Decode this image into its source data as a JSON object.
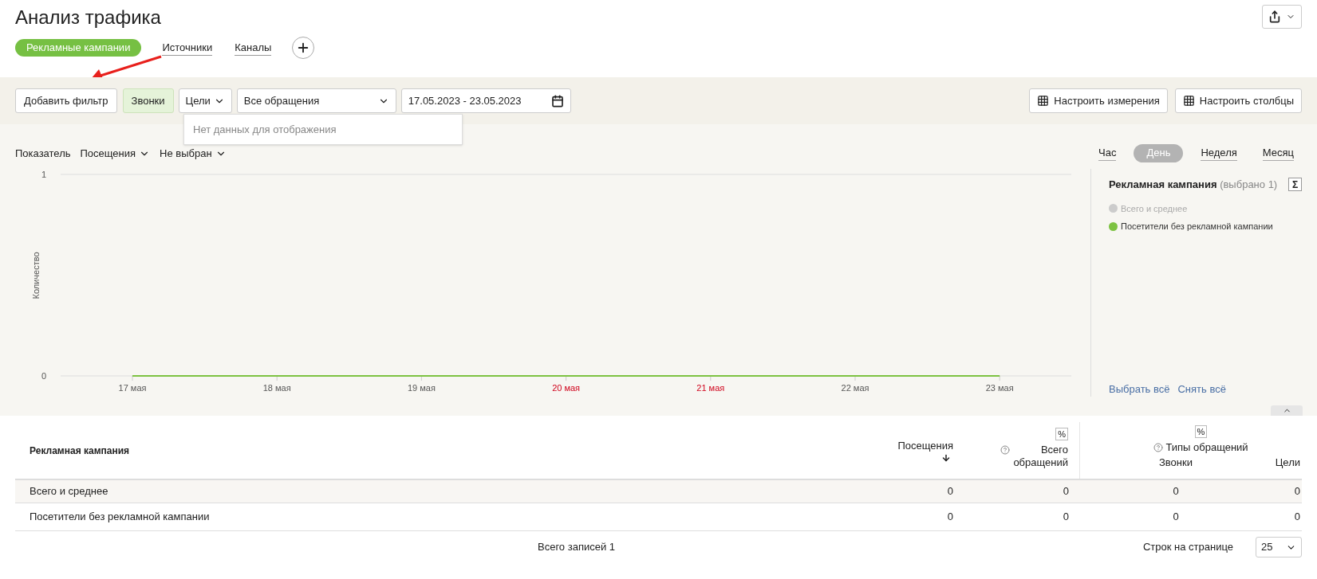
{
  "page": {
    "title": "Анализ трафика"
  },
  "report_tabs": [
    {
      "label": "Рекламные кампании",
      "selected": true
    },
    {
      "label": "Источники",
      "selected": false
    },
    {
      "label": "Каналы",
      "selected": false
    }
  ],
  "filter_bar": {
    "add_filter": "Добавить фильтр",
    "calls_chip": "Звонки",
    "goals_dropdown": "Цели",
    "requests_select": "Все обращения",
    "date_range": "17.05.2023 - 23.05.2023",
    "dropdown_empty": "Нет данных для отображения",
    "dimensions_button": "Настроить измерения",
    "columns_button": "Настроить столбцы"
  },
  "chart_controls": {
    "metric_label": "Показатель",
    "metric": "Посещения",
    "second_metric": "Не выбран"
  },
  "granularity": [
    {
      "label": "Час",
      "selected": false
    },
    {
      "label": "День",
      "selected": true
    },
    {
      "label": "Неделя",
      "selected": false
    },
    {
      "label": "Месяц",
      "selected": false
    }
  ],
  "chart": {
    "weekend": [
      false,
      false,
      false,
      true,
      true,
      false,
      false
    ],
    "chart_data": {
      "type": "line",
      "ylabel": "Количество",
      "categories": [
        "17 мая",
        "18 мая",
        "19 мая",
        "20 мая",
        "21 мая",
        "22 мая",
        "23 мая"
      ],
      "ylim": [
        0,
        1
      ],
      "yticks": [
        0,
        1
      ],
      "series": [
        {
          "color": "#7dc242",
          "values": [
            0,
            0,
            0,
            0,
            0,
            0,
            0
          ]
        }
      ]
    }
  },
  "legend": {
    "title": "Рекламная кампания",
    "selection": "(выбрано 1)",
    "sum_button": "Σ",
    "items": [
      {
        "label": "Всего и среднее",
        "color": "#cccccc",
        "selected": false
      },
      {
        "label": "Посетители без рекламной кампании",
        "color": "#7dc242",
        "selected": true
      }
    ],
    "select_all": "Выбрать всё",
    "clear_all": "Снять всё"
  },
  "table": {
    "columns": {
      "campaign": "Рекламная кампания",
      "visits": "Посещения",
      "percent_1": "%",
      "total_requests": "Всего обращений",
      "percent_2": "%",
      "request_types": "Типы обращений",
      "calls": "Звонки",
      "goals": "Цели"
    },
    "rows": [
      {
        "campaign": "Всего и среднее",
        "visits": "0",
        "total_requests": "0",
        "calls": "0",
        "goals": "0",
        "kind": "total"
      },
      {
        "campaign": "Посетители без рекламной кампании",
        "visits": "0",
        "total_requests": "0",
        "calls": "0",
        "goals": "0",
        "kind": "row"
      }
    ],
    "total_records": "Всего записей 1",
    "rows_per_page_label": "Строк на странице",
    "rows_per_page": "25"
  }
}
